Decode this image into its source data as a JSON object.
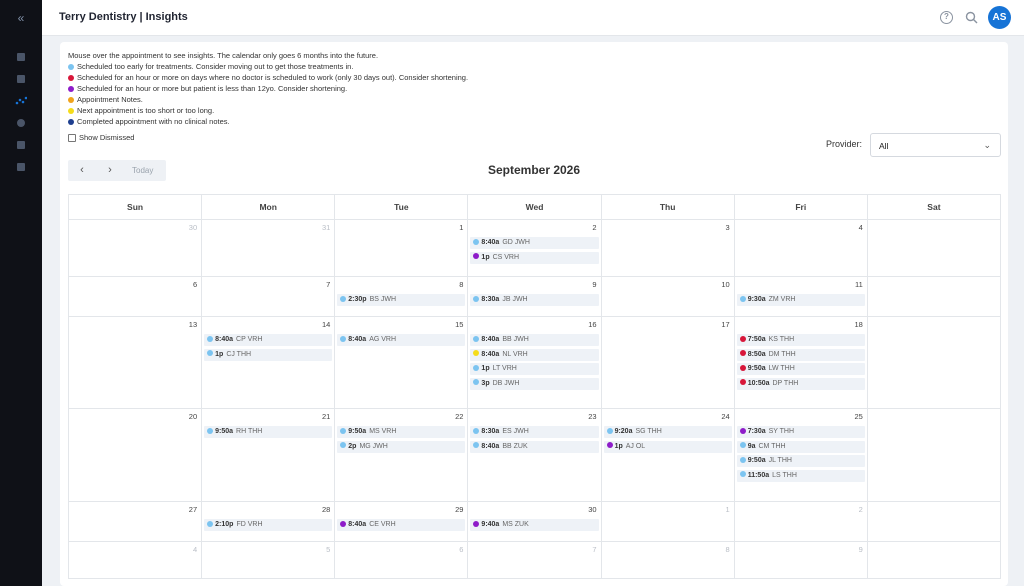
{
  "app": {
    "title": "Terry Dentistry | Insights",
    "user_initials": "AS"
  },
  "colors": {
    "too_early": "#7cc4f0",
    "no_doctor": "#d8173a",
    "under_12": "#8e1cc9",
    "notes": "#f0a31c",
    "next_appt": "#f5dc1a",
    "no_notes": "#1e3f8f",
    "accent": "#1673d6"
  },
  "legend": {
    "intro": "Mouse over the appointment to see insights. The calendar only goes 6 months into the future.",
    "items": [
      {
        "key": "too_early",
        "color": "#7cc4f0",
        "text": "Scheduled too early for treatments. Consider moving out to get those treatments in."
      },
      {
        "key": "no_doctor",
        "color": "#d8173a",
        "text": "Scheduled for an hour or more on days where no doctor is scheduled to work (only 30 days out). Consider shortening."
      },
      {
        "key": "under_12",
        "color": "#8e1cc9",
        "text": "Scheduled for an hour or more but patient is less than 12yo. Consider shortening."
      },
      {
        "key": "notes",
        "color": "#f0a31c",
        "text": "Appointment Notes."
      },
      {
        "key": "next_appt",
        "color": "#f5dc1a",
        "text": "Next appointment is too short or too long."
      },
      {
        "key": "no_notes",
        "color": "#1e3f8f",
        "text": "Completed appointment with no clinical notes."
      }
    ],
    "show_dismissed": "Show Dismissed"
  },
  "provider": {
    "label": "Provider:",
    "value": "All"
  },
  "nav": {
    "prev": "‹",
    "next": "›",
    "today": "Today"
  },
  "calendar": {
    "month_label": "September 2026",
    "day_headers": [
      "Sun",
      "Mon",
      "Tue",
      "Wed",
      "Thu",
      "Fri",
      "Sat"
    ],
    "weeks": [
      {
        "days": [
          {
            "num": "30",
            "dim": true,
            "events": []
          },
          {
            "num": "31",
            "dim": true,
            "events": []
          },
          {
            "num": "1",
            "events": []
          },
          {
            "num": "2",
            "events": [
              {
                "time": "8:40a",
                "code": "GD JWH",
                "color": "too_early"
              },
              {
                "time": "1p",
                "code": "CS VRH",
                "color": "under_12"
              }
            ]
          },
          {
            "num": "3",
            "events": []
          },
          {
            "num": "4",
            "events": []
          },
          {
            "num": "",
            "events": []
          }
        ]
      },
      {
        "days": [
          {
            "num": "6",
            "events": []
          },
          {
            "num": "7",
            "events": []
          },
          {
            "num": "8",
            "events": [
              {
                "time": "2:30p",
                "code": "BS JWH",
                "color": "too_early"
              }
            ]
          },
          {
            "num": "9",
            "events": [
              {
                "time": "8:30a",
                "code": "JB JWH",
                "color": "too_early"
              }
            ]
          },
          {
            "num": "10",
            "events": []
          },
          {
            "num": "11",
            "events": [
              {
                "time": "9:30a",
                "code": "ZM VRH",
                "color": "too_early"
              }
            ]
          },
          {
            "num": "",
            "events": []
          }
        ]
      },
      {
        "days": [
          {
            "num": "13",
            "events": []
          },
          {
            "num": "14",
            "events": [
              {
                "time": "8:40a",
                "code": "CP VRH",
                "color": "too_early"
              },
              {
                "time": "1p",
                "code": "CJ THH",
                "color": "too_early"
              }
            ]
          },
          {
            "num": "15",
            "events": [
              {
                "time": "8:40a",
                "code": "AG VRH",
                "color": "too_early"
              }
            ]
          },
          {
            "num": "16",
            "events": [
              {
                "time": "8:40a",
                "code": "BB JWH",
                "color": "too_early"
              },
              {
                "time": "8:40a",
                "code": "NL VRH",
                "color": "next_appt"
              },
              {
                "time": "1p",
                "code": "LT VRH",
                "color": "too_early"
              },
              {
                "time": "3p",
                "code": "DB JWH",
                "color": "too_early"
              }
            ]
          },
          {
            "num": "17",
            "events": []
          },
          {
            "num": "18",
            "events": [
              {
                "time": "7:50a",
                "code": "KS THH",
                "color": "no_doctor"
              },
              {
                "time": "8:50a",
                "code": "DM THH",
                "color": "no_doctor"
              },
              {
                "time": "9:50a",
                "code": "LW THH",
                "color": "no_doctor"
              },
              {
                "time": "10:50a",
                "code": "DP THH",
                "color": "no_doctor"
              }
            ]
          },
          {
            "num": "",
            "events": []
          }
        ]
      },
      {
        "days": [
          {
            "num": "20",
            "events": []
          },
          {
            "num": "21",
            "events": [
              {
                "time": "9:50a",
                "code": "RH THH",
                "color": "too_early"
              }
            ]
          },
          {
            "num": "22",
            "events": [
              {
                "time": "9:50a",
                "code": "MS VRH",
                "color": "too_early"
              },
              {
                "time": "2p",
                "code": "MG JWH",
                "color": "too_early"
              }
            ]
          },
          {
            "num": "23",
            "events": [
              {
                "time": "8:30a",
                "code": "ES JWH",
                "color": "too_early"
              },
              {
                "time": "8:40a",
                "code": "BB ZUK",
                "color": "too_early"
              }
            ]
          },
          {
            "num": "24",
            "events": [
              {
                "time": "9:20a",
                "code": "SG THH",
                "color": "too_early"
              },
              {
                "time": "1p",
                "code": "AJ OL",
                "color": "under_12"
              }
            ]
          },
          {
            "num": "25",
            "events": [
              {
                "time": "7:30a",
                "code": "SY THH",
                "color": "under_12"
              },
              {
                "time": "9a",
                "code": "CM THH",
                "color": "too_early"
              },
              {
                "time": "9:50a",
                "code": "JL THH",
                "color": "too_early"
              },
              {
                "time": "11:50a",
                "code": "LS THH",
                "color": "too_early"
              }
            ]
          },
          {
            "num": "",
            "events": []
          }
        ]
      },
      {
        "days": [
          {
            "num": "27",
            "events": []
          },
          {
            "num": "28",
            "events": [
              {
                "time": "2:10p",
                "code": "FD VRH",
                "color": "too_early"
              }
            ]
          },
          {
            "num": "29",
            "events": [
              {
                "time": "8:40a",
                "code": "CE VRH",
                "color": "under_12"
              }
            ]
          },
          {
            "num": "30",
            "events": [
              {
                "time": "9:40a",
                "code": "MS ZUK",
                "color": "under_12"
              }
            ]
          },
          {
            "num": "1",
            "dim": true,
            "events": []
          },
          {
            "num": "2",
            "dim": true,
            "events": []
          },
          {
            "num": "",
            "events": []
          }
        ]
      },
      {
        "days": [
          {
            "num": "4",
            "dim": true,
            "events": []
          },
          {
            "num": "5",
            "dim": true,
            "events": []
          },
          {
            "num": "6",
            "dim": true,
            "events": []
          },
          {
            "num": "7",
            "dim": true,
            "events": []
          },
          {
            "num": "8",
            "dim": true,
            "events": []
          },
          {
            "num": "9",
            "dim": true,
            "events": []
          },
          {
            "num": "",
            "events": []
          }
        ]
      }
    ]
  }
}
